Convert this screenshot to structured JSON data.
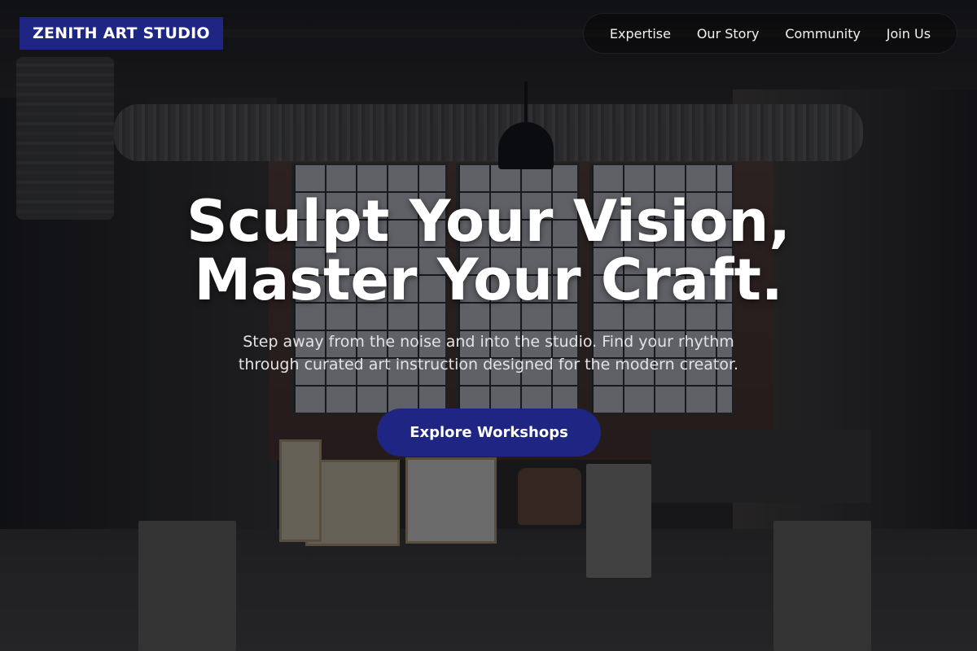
{
  "brand": {
    "name": "ZENITH ART STUDIO",
    "color": "#1f2583"
  },
  "nav": {
    "items": [
      {
        "label": "Expertise"
      },
      {
        "label": "Our Story"
      },
      {
        "label": "Community"
      },
      {
        "label": "Join Us"
      }
    ]
  },
  "hero": {
    "title_line1": "Sculpt Your Vision,",
    "title_line2": "Master Your Craft.",
    "subtitle_line1": "Step away from the noise and into the studio. Find your rhythm",
    "subtitle_line2": "through curated art instruction designed for the modern creator.",
    "cta_label": "Explore Workshops"
  }
}
